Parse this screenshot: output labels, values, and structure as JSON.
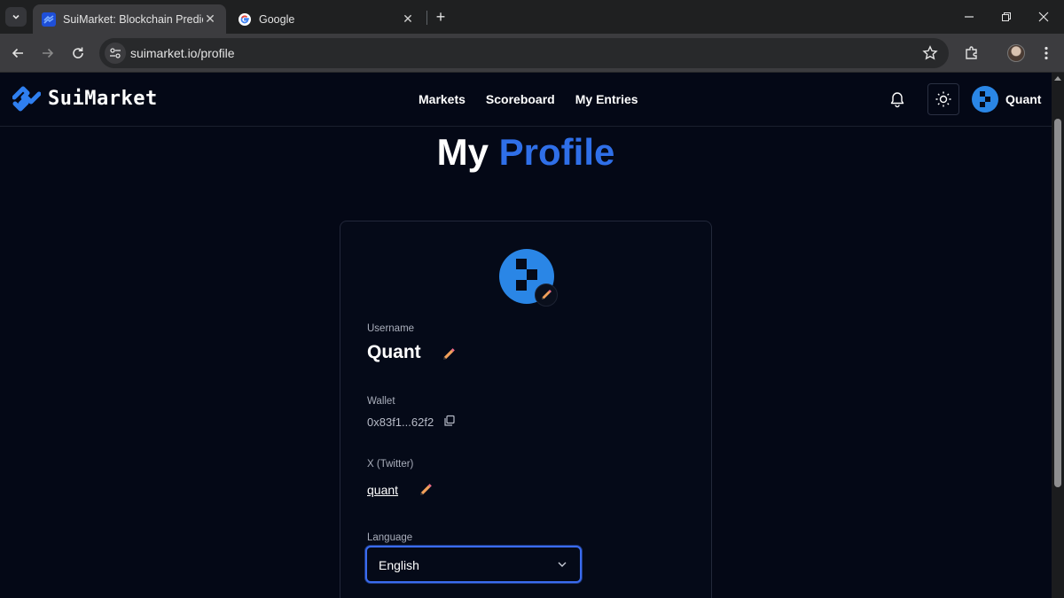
{
  "browser": {
    "tabs": [
      {
        "title": "SuiMarket: Blockchain Prediction",
        "active": true
      },
      {
        "title": "Google",
        "active": false
      }
    ],
    "url": "suimarket.io/profile"
  },
  "site": {
    "logo_text": "SuiMarket",
    "nav": [
      "Markets",
      "Scoreboard",
      "My Entries"
    ],
    "user_name": "Quant",
    "brand_color": "#2f6fe8"
  },
  "page": {
    "title_first": "My",
    "title_accent": "Profile"
  },
  "profile": {
    "username_label": "Username",
    "username": "Quant",
    "wallet_label": "Wallet",
    "wallet": "0x83f1...62f2",
    "twitter_label": "X (Twitter)",
    "twitter": "quant",
    "language_label": "Language",
    "language": "English"
  }
}
